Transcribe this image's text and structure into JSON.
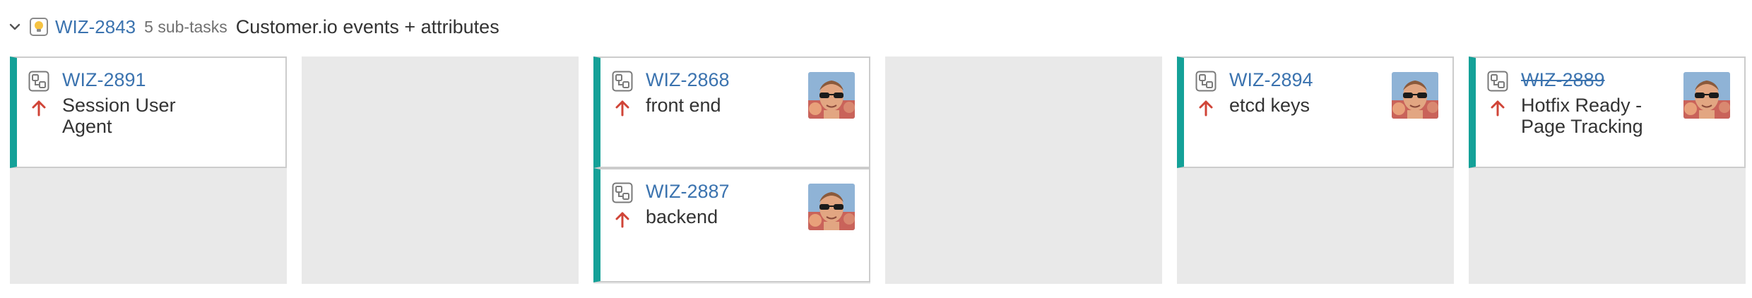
{
  "swimlane": {
    "parent_key": "WIZ-2843",
    "subtask_count": "5 sub-tasks",
    "summary": "Customer.io events + attributes",
    "icon": "story-lightbulb-icon",
    "expand_icon": "chevron-down-icon"
  },
  "columns": [
    {
      "cards": [
        {
          "key": "WIZ-2891",
          "summary": "Session User Agent",
          "priority": "high",
          "done": false,
          "assignee_avatar": false
        }
      ]
    },
    {
      "cards": []
    },
    {
      "cards": [
        {
          "key": "WIZ-2868",
          "summary": "front end",
          "priority": "high",
          "done": false,
          "assignee_avatar": true
        },
        {
          "key": "WIZ-2887",
          "summary": "backend",
          "priority": "high",
          "done": false,
          "assignee_avatar": true
        }
      ]
    },
    {
      "cards": []
    },
    {
      "cards": [
        {
          "key": "WIZ-2894",
          "summary": "etcd keys",
          "priority": "high",
          "done": false,
          "assignee_avatar": true
        }
      ]
    },
    {
      "cards": [
        {
          "key": "WIZ-2889",
          "summary": "Hotfix Ready - Page Tracking",
          "priority": "high",
          "done": true,
          "assignee_avatar": true
        }
      ]
    }
  ],
  "colors": {
    "card_accent": "#14a198",
    "link": "#3b73af",
    "priority_up": "#d04437",
    "column_bg": "#e9e9e9"
  }
}
